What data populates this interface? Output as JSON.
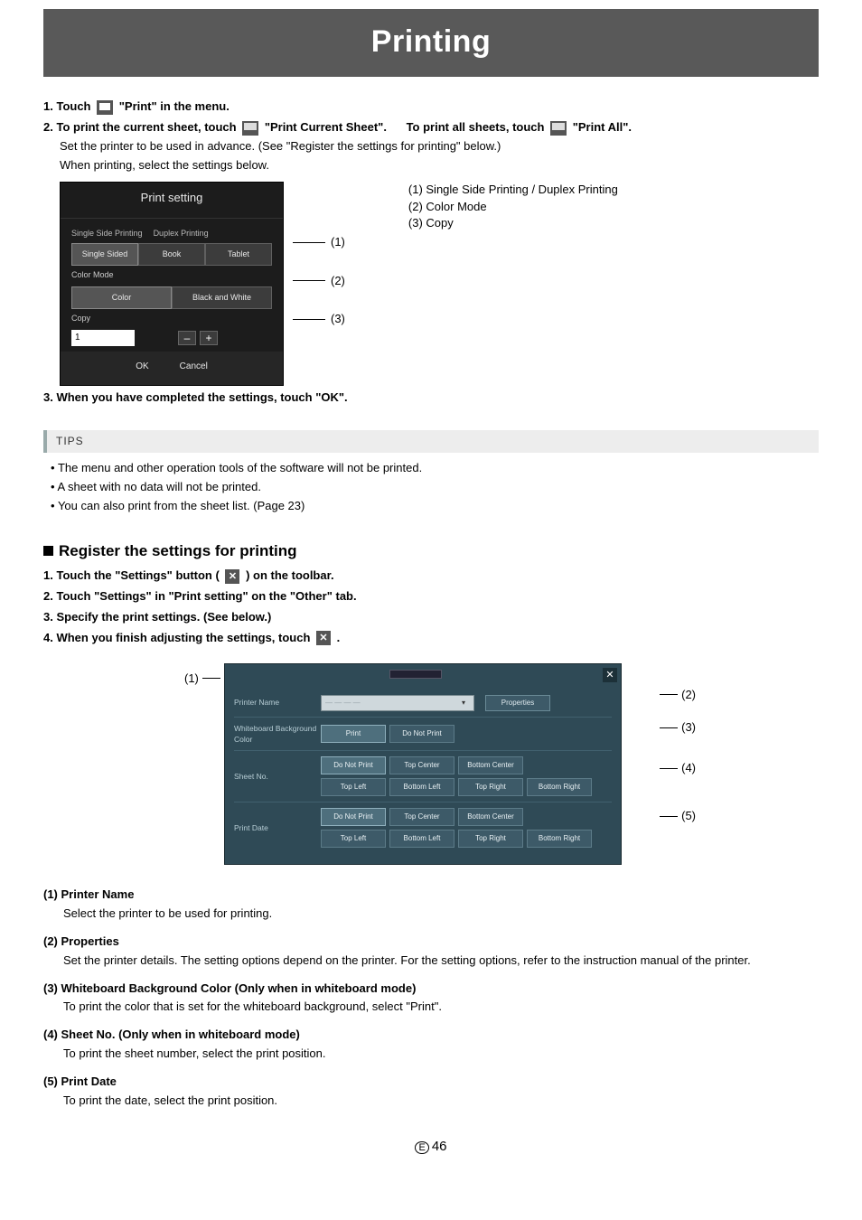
{
  "banner": "Printing",
  "steps_a": [
    {
      "n": "1.",
      "pre": "Touch ",
      "icon": "print",
      "post": " \"Print\" in the menu."
    },
    {
      "n": "2.",
      "pre": "To print the current sheet, touch ",
      "icon": "printcur",
      "post": " \"Print Current Sheet\"."
    }
  ],
  "step2b": {
    "pre": "To print all sheets, touch ",
    "icon": "printall",
    "post": " \"Print All\"."
  },
  "body_a": [
    "Set the printer to be used in advance. (See \"Register the settings for printing\" below.)",
    "When printing, select the settings below."
  ],
  "ps": {
    "title": "Print setting",
    "tabs": [
      "Single Side Printing",
      "Duplex Printing"
    ],
    "row1": [
      "Single Sided",
      "Book",
      "Tablet"
    ],
    "color_label": "Color Mode",
    "row2": [
      "Color",
      "Black and White"
    ],
    "copy_label": "Copy",
    "copy_value": "1",
    "ok": "OK",
    "cancel": "Cancel"
  },
  "ann_a": [
    "(1)",
    "(2)",
    "(3)"
  ],
  "notes_a": [
    "(1) Single Side Printing / Duplex Printing",
    "(2) Color Mode",
    "(3) Copy"
  ],
  "step3": "3.  When you have completed the settings, touch \"OK\".",
  "tips_head": "TIPS",
  "tips": [
    "The menu and other operation tools of the software will not be printed.",
    "A sheet with no data will not be printed.",
    "You can also print from the sheet list. (Page 23)"
  ],
  "section_b": "Register the settings for printing",
  "steps_b": [
    {
      "n": "1.",
      "pre": "Touch the \"Settings\" button (",
      "icon": "close",
      "post": ") on the toolbar."
    },
    {
      "n": "2.",
      "t": "Touch \"Settings\" in \"Print setting\" on the \"Other\" tab."
    },
    {
      "n": "3.",
      "t": "Specify the print settings. (See below.)"
    },
    {
      "n": "4.",
      "pre": "When you finish adjusting the settings, touch ",
      "icon": "close",
      "post": "."
    }
  ],
  "set": {
    "rows": {
      "printer": {
        "label": "Printer Name",
        "prop": "Properties"
      },
      "bg": {
        "label": "Whiteboard Background Color",
        "opts": [
          "Print",
          "Do Not Print"
        ]
      },
      "sheet": {
        "label": "Sheet No.",
        "r1": [
          "Do Not Print",
          "Top Center",
          "Bottom Center"
        ],
        "r2": [
          "Top Left",
          "Bottom Left",
          "Top Right",
          "Bottom Right"
        ]
      },
      "date": {
        "label": "Print Date",
        "r1": [
          "Do Not Print",
          "Top Center",
          "Bottom Center"
        ],
        "r2": [
          "Top Left",
          "Bottom Left",
          "Top Right",
          "Bottom Right"
        ]
      }
    }
  },
  "ann_b_left": "(1)",
  "ann_b": [
    "(2)",
    "(3)",
    "(4)",
    "(5)"
  ],
  "defs": [
    {
      "h": "(1) Printer Name",
      "b": "Select the printer to be used for printing."
    },
    {
      "h": "(2) Properties",
      "b": "Set the printer details. The setting options depend on the printer. For the setting options, refer to the instruction manual of the printer."
    },
    {
      "h": "(3) Whiteboard Background Color (Only when in whiteboard mode)",
      "b": "To print the color that is set for the whiteboard background, select \"Print\"."
    },
    {
      "h": "(4) Sheet No. (Only when in whiteboard mode)",
      "b": "To print the sheet number, select the print position."
    },
    {
      "h": "(5) Print Date",
      "b": "To print the date, select the print position."
    }
  ],
  "page_number": "46",
  "page_e": "E"
}
